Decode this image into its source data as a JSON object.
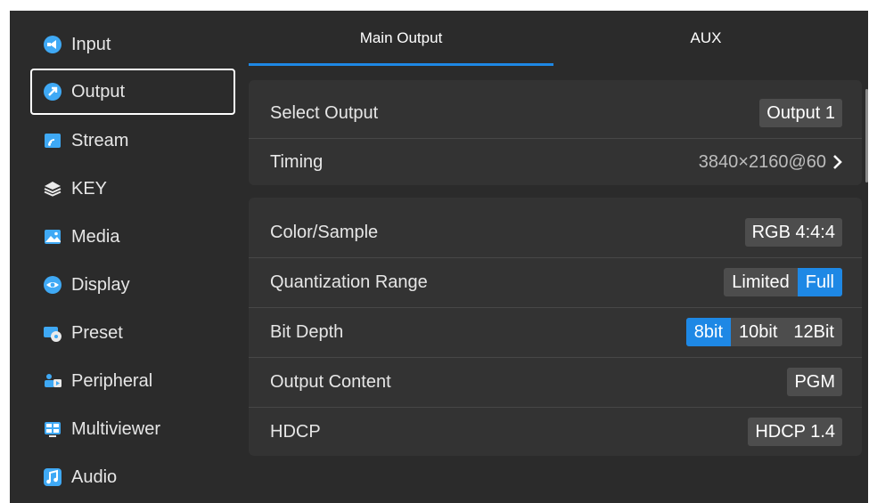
{
  "sidebar": {
    "items": [
      {
        "label": "Input",
        "icon": "input-icon"
      },
      {
        "label": "Output",
        "icon": "output-icon"
      },
      {
        "label": "Stream",
        "icon": "stream-icon"
      },
      {
        "label": "KEY",
        "icon": "key-layers-icon"
      },
      {
        "label": "Media",
        "icon": "media-image-icon"
      },
      {
        "label": "Display",
        "icon": "display-icon"
      },
      {
        "label": "Preset",
        "icon": "preset-icon"
      },
      {
        "label": "Peripheral",
        "icon": "peripheral-icon"
      },
      {
        "label": "Multiviewer",
        "icon": "multiviewer-icon"
      },
      {
        "label": "Audio",
        "icon": "audio-icon"
      }
    ],
    "active": "Output"
  },
  "tabs": {
    "main_output": "Main Output",
    "aux": "AUX",
    "active": "Main Output"
  },
  "output_card": {
    "select_output": {
      "label": "Select Output",
      "value": "Output 1"
    },
    "timing": {
      "label": "Timing",
      "value": "3840×2160@60"
    }
  },
  "settings_card": {
    "color_sample": {
      "label": "Color/Sample",
      "value": "RGB 4:4:4"
    },
    "quantization": {
      "label": "Quantization Range",
      "options": [
        "Limited",
        "Full"
      ],
      "selected": "Full"
    },
    "bit_depth": {
      "label": "Bit Depth",
      "options": [
        "8bit",
        "10bit",
        "12Bit"
      ],
      "selected": "8bit"
    },
    "output_content": {
      "label": "Output Content",
      "value": "PGM"
    },
    "hdcp": {
      "label": "HDCP",
      "value": "HDCP 1.4"
    }
  },
  "colors": {
    "accent": "#1e88e5",
    "background": "#2b2b2b",
    "card": "#333333",
    "chip": "#4d4d4d"
  }
}
